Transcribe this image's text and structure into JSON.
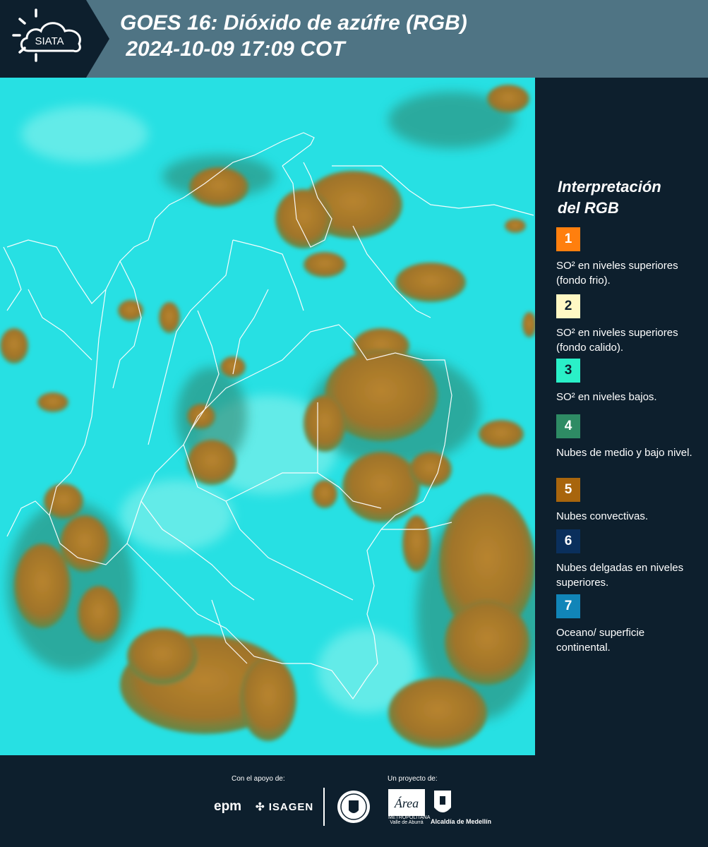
{
  "header": {
    "logo_text": "SIATA",
    "title_line1": "GOES 16: Dióxido de azúfre (RGB)",
    "title_line2": " 2024-10-09 17:09 COT"
  },
  "legend": {
    "title_line1": "Interpretación",
    "title_line2": "del RGB",
    "items": [
      {
        "number": "1",
        "text": "SO² en niveles superiores (fondo frio).",
        "color": "#ff7f0e",
        "text_color": "#ffffff"
      },
      {
        "number": "2",
        "text": "SO² en niveles superiores (fondo calido).",
        "color": "#fff8c4",
        "text_color": "#0d1f2d"
      },
      {
        "number": "3",
        "text": "SO² en niveles bajos.",
        "color": "#2af0c8",
        "text_color": "#0d1f2d"
      },
      {
        "number": "4",
        "text": "Nubes de medio y bajo nivel.",
        "color": "#2e8b64",
        "text_color": "#ffffff"
      },
      {
        "number": "5",
        "text": "Nubes convectivas.",
        "color": "#a8650d",
        "text_color": "#ffffff"
      },
      {
        "number": "6",
        "text": "Nubes delgadas en niveles superiores.",
        "color": "#0a2f5c",
        "text_color": "#ffffff"
      },
      {
        "number": "7",
        "text": "Oceano/ superficie continental.",
        "color": "#1185b8",
        "text_color": "#ffffff"
      }
    ]
  },
  "footer": {
    "support_label": "Con el apoyo de:",
    "project_label": "Un proyecto de:",
    "sponsor1": "epm",
    "sponsor2": "ISAGEN",
    "partner_area": "Área",
    "partner_area_sub": "METROPOLITANA",
    "partner_area_sub2": "Valle de Aburrá",
    "partner_alcaldia": "Alcaldía de Medellín"
  },
  "colors": {
    "background": "#0d1f2d",
    "header": "#4f7484",
    "map_cyan": "#27e0e3",
    "cloud_brown": "#a8782c"
  }
}
